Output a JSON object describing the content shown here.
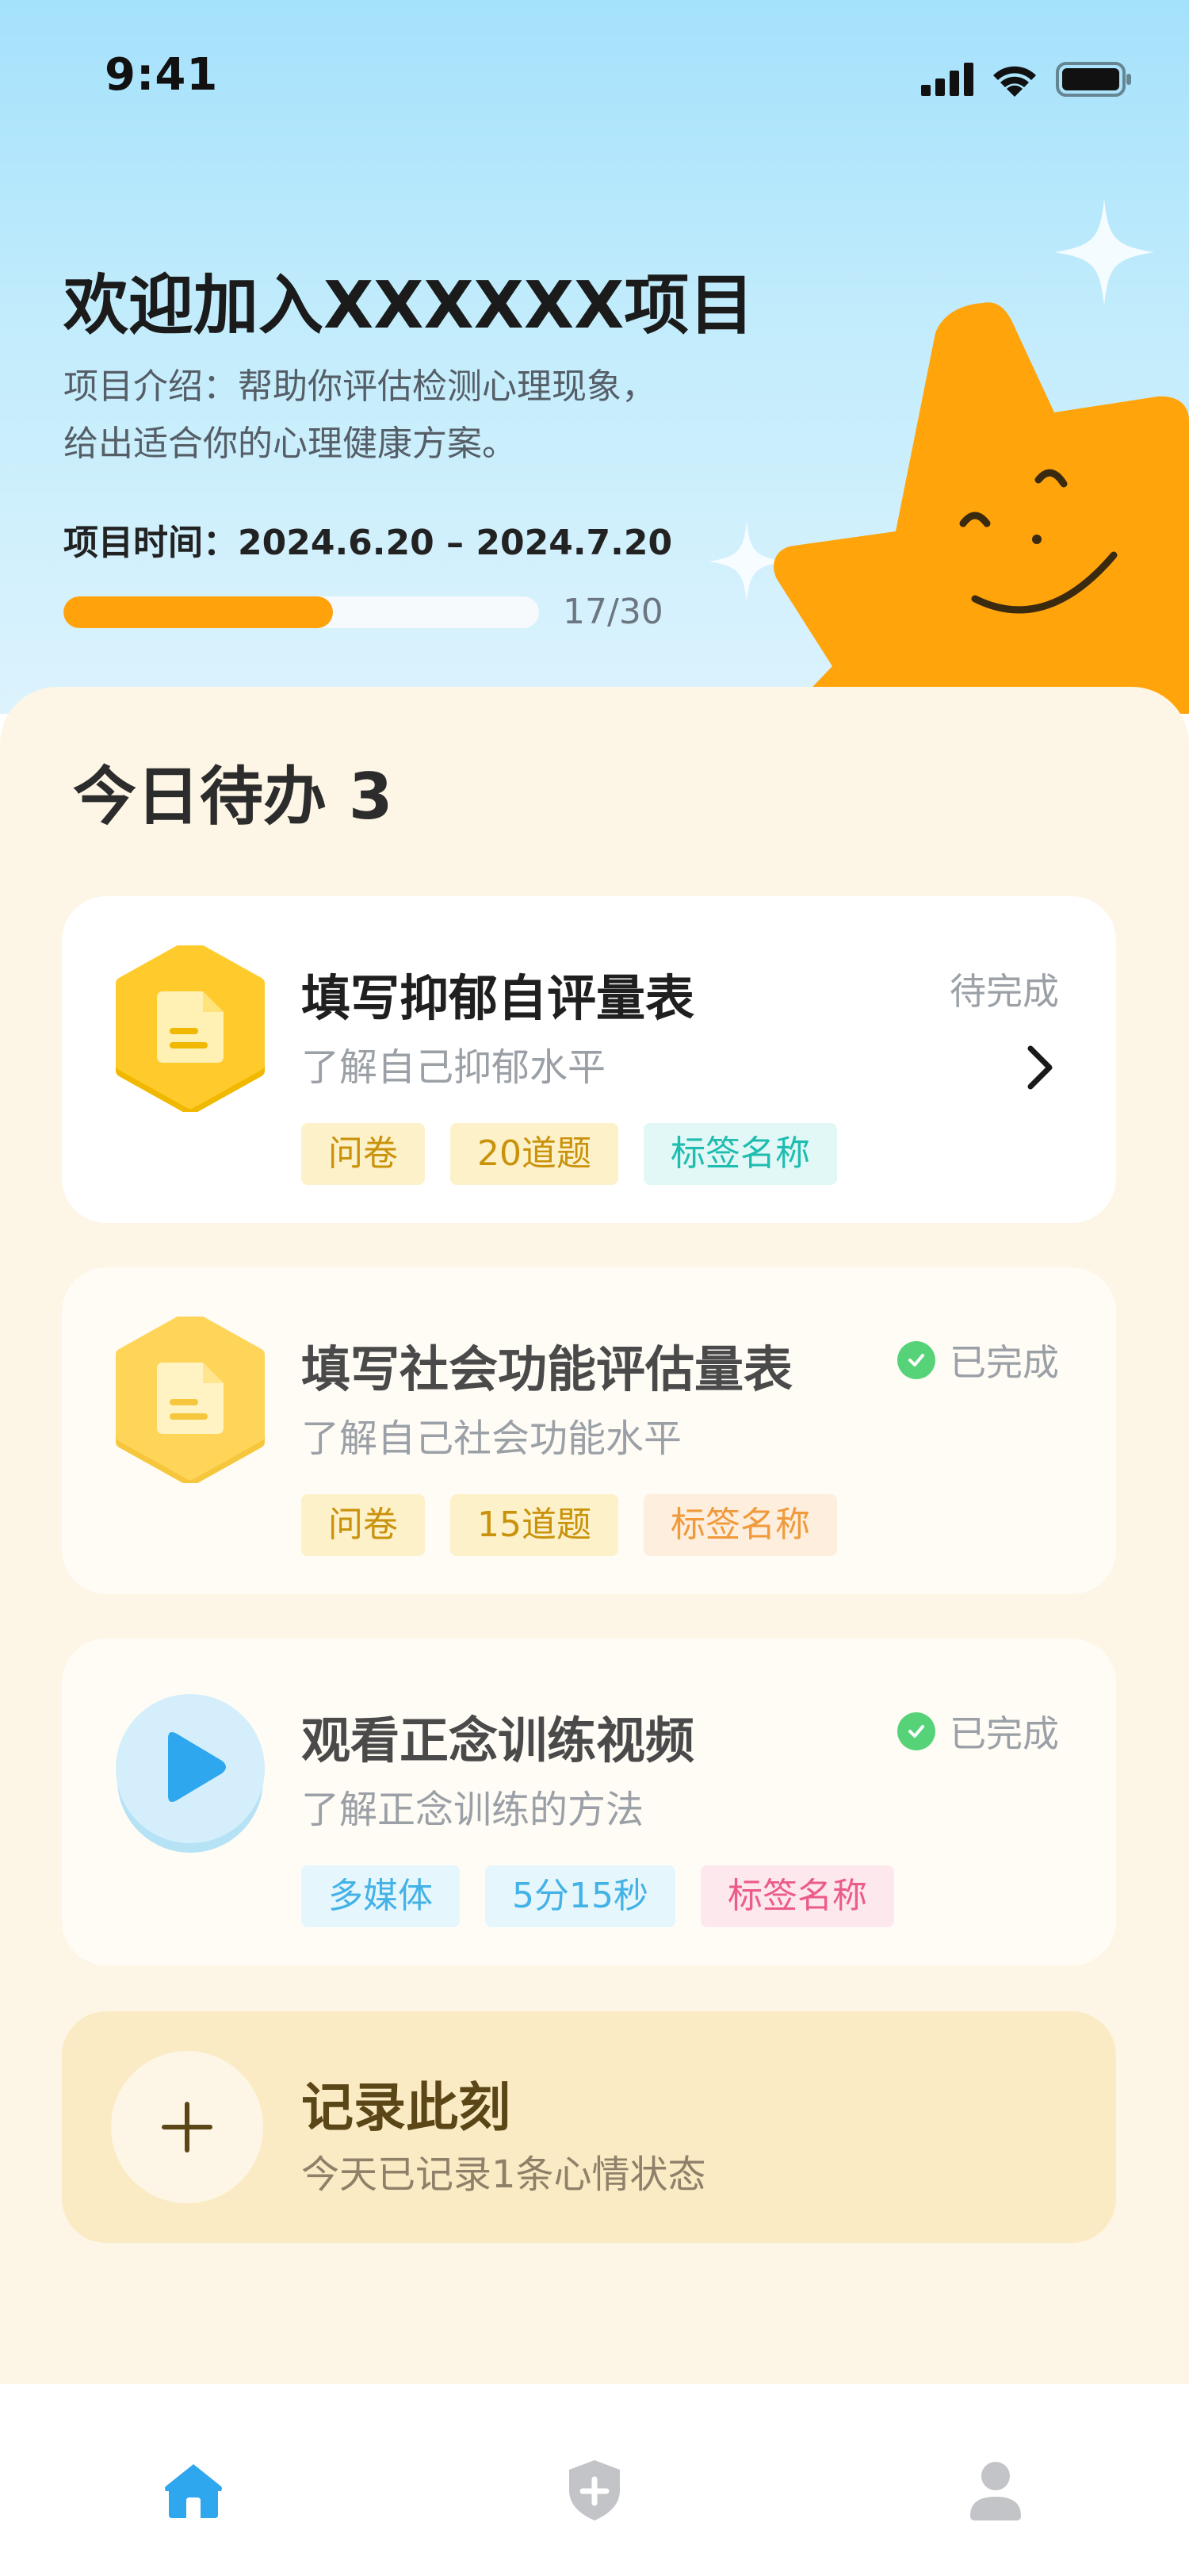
{
  "status_bar": {
    "time": "9:41",
    "icons": [
      "signal-icon",
      "wifi-icon",
      "battery-icon"
    ]
  },
  "header": {
    "title": "欢迎加入XXXXXX项目",
    "intro_line1": "项目介绍：帮助你评估检测心理现象，",
    "intro_line2": "给出适合你的心理健康方案。",
    "period": "项目时间：2024.6.20 – 2024.7.20",
    "progress": {
      "current": 17,
      "total": 30,
      "text": "17/30"
    }
  },
  "todo": {
    "title": "今日待办 3",
    "items": [
      {
        "title": "填写抑郁自评量表",
        "subtitle": "了解自己抑郁水平",
        "status": "待完成",
        "icon": "document-icon",
        "tags": [
          "问卷",
          "20道题",
          "标签名称"
        ]
      },
      {
        "title": "填写社会功能评估量表",
        "subtitle": "了解自己社会功能水平",
        "status": "已完成",
        "icon": "document-icon",
        "tags": [
          "问卷",
          "15道题",
          "标签名称"
        ]
      },
      {
        "title": "观看正念训练视频",
        "subtitle": "了解正念训练的方法",
        "status": "已完成",
        "icon": "play-icon",
        "tags": [
          "多媒体",
          "5分15秒",
          "标签名称"
        ]
      }
    ]
  },
  "record": {
    "title": "记录此刻",
    "subtitle": "今天已记录1条心情状态"
  },
  "tabbar": {
    "tabs": [
      "home-icon",
      "shield-plus-icon",
      "profile-icon"
    ],
    "active": 0
  },
  "colors": {
    "accent": "#ffa20c",
    "sun": "#ffa40b",
    "done_check": "#56d378",
    "active_tab": "#2fa7ee"
  }
}
